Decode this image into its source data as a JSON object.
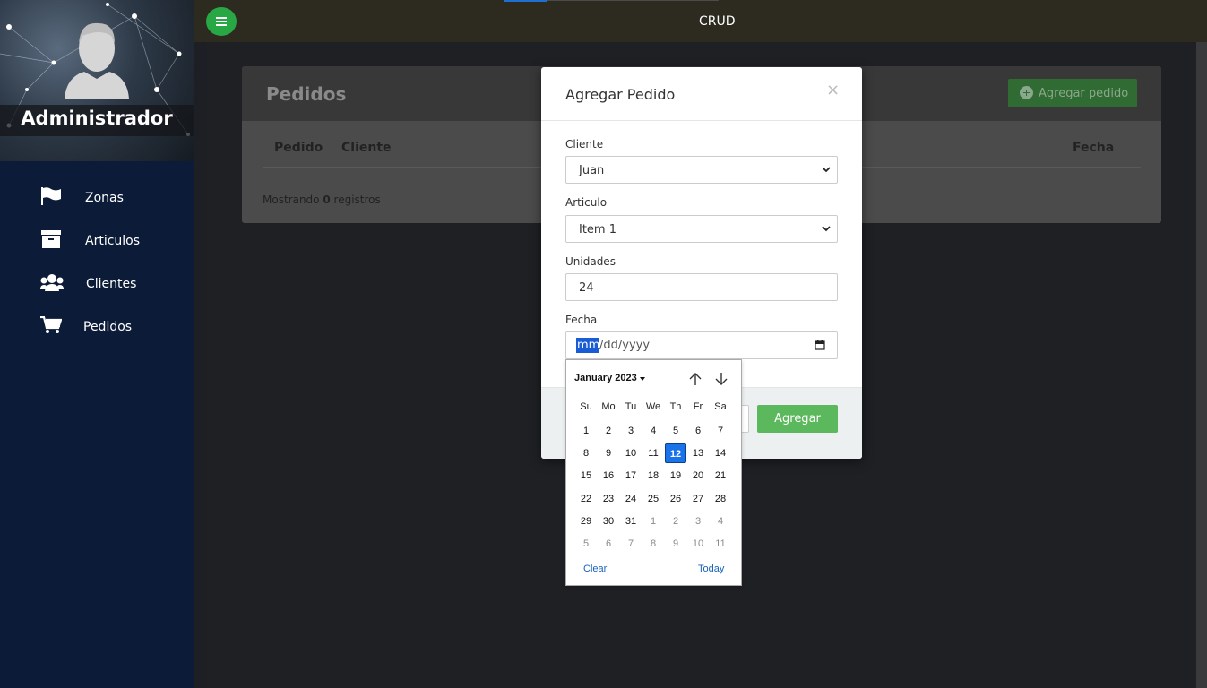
{
  "sidebar": {
    "admin_name": "Administrador",
    "items": [
      {
        "label": "Zonas",
        "icon": "flag-icon"
      },
      {
        "label": "Articulos",
        "icon": "archive-icon"
      },
      {
        "label": "Clientes",
        "icon": "users-icon"
      },
      {
        "label": "Pedidos",
        "icon": "cart-icon"
      }
    ]
  },
  "topbar": {
    "title": "CRUD"
  },
  "card": {
    "title": "Pedidos",
    "add_button": "Agregar pedido",
    "columns": [
      "Pedido",
      "Cliente",
      "Fecha"
    ],
    "showing_prefix": "Mostrando",
    "showing_count": "0",
    "showing_suffix": "registros"
  },
  "modal": {
    "title": "Agregar Pedido",
    "close": "×",
    "fields": {
      "cliente": {
        "label": "Cliente",
        "value": "Juan"
      },
      "articulo": {
        "label": "Articulo",
        "value": "Item 1"
      },
      "unidades": {
        "label": "Unidades",
        "value": "24"
      },
      "fecha": {
        "label": "Fecha",
        "mm": "mm",
        "rest": "/dd/yyyy"
      }
    },
    "submit": "Agregar"
  },
  "datepicker": {
    "month_label": "January 2023",
    "weekdays": [
      "Su",
      "Mo",
      "Tu",
      "We",
      "Th",
      "Fr",
      "Sa"
    ],
    "selected_day": "12",
    "weeks": [
      [
        "1",
        "2",
        "3",
        "4",
        "5",
        "6",
        "7"
      ],
      [
        "8",
        "9",
        "10",
        "11",
        "12",
        "13",
        "14"
      ],
      [
        "15",
        "16",
        "17",
        "18",
        "19",
        "20",
        "21"
      ],
      [
        "22",
        "23",
        "24",
        "25",
        "26",
        "27",
        "28"
      ],
      [
        "29",
        "30",
        "31",
        "1",
        "2",
        "3",
        "4"
      ],
      [
        "5",
        "6",
        "7",
        "8",
        "9",
        "10",
        "11"
      ]
    ],
    "clear": "Clear",
    "today": "Today"
  },
  "colors": {
    "sidebar_bg": "#0c1c38",
    "accent_green": "#5cb85c",
    "selected_blue": "#1a73e8"
  }
}
